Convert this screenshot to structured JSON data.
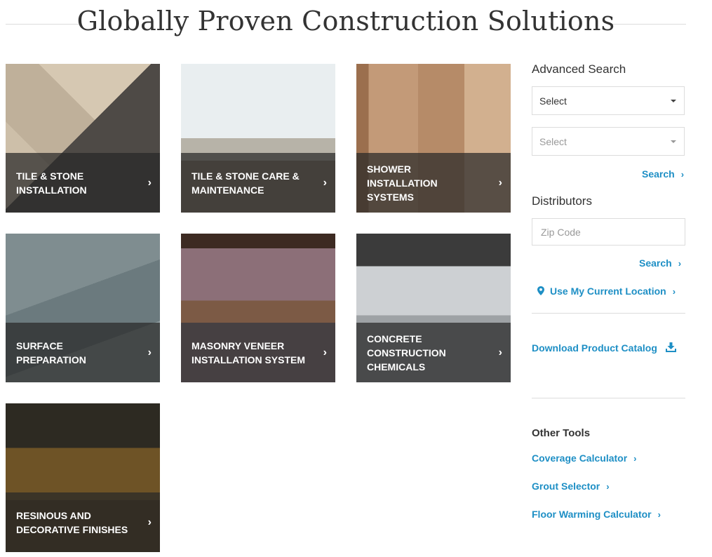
{
  "page": {
    "heading": "Globally Proven Construction Solutions"
  },
  "tiles": [
    {
      "label": "TILE & STONE INSTALLATION"
    },
    {
      "label": "TILE & STONE CARE & MAINTENANCE"
    },
    {
      "label": "SHOWER INSTALLATION SYSTEMS"
    },
    {
      "label": "SURFACE PREPARATION"
    },
    {
      "label": "MASONRY VENEER INSTALLATION SYSTEM"
    },
    {
      "label": "CONCRETE CONSTRUCTION CHEMICALS"
    },
    {
      "label": "RESINOUS AND DECORATIVE FINISHES"
    }
  ],
  "sidebar": {
    "advanced_search": {
      "title": "Advanced Search",
      "select1": "Select",
      "select2": "Select",
      "search_label": "Search"
    },
    "distributors": {
      "title": "Distributors",
      "zip_placeholder": "Zip Code",
      "search_label": "Search",
      "location_label": "Use My Current Location"
    },
    "download_label": "Download Product Catalog",
    "other_tools": {
      "title": "Other Tools",
      "items": [
        "Coverage Calculator",
        "Grout Selector",
        "Floor Warming Calculator"
      ]
    }
  },
  "colors": {
    "link": "#1e8fc5",
    "overlay": "#282828"
  }
}
